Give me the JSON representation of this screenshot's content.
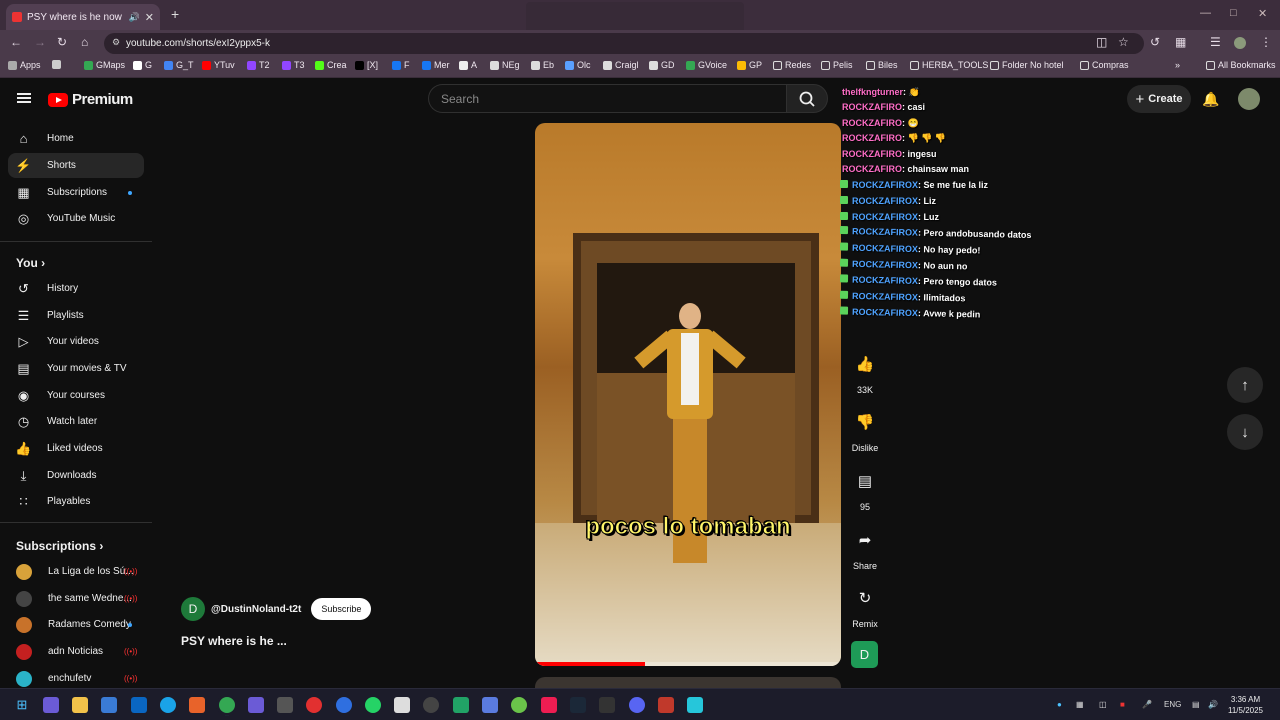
{
  "browser": {
    "tab_title": "PSY where is he now #fyp #",
    "url": "youtube.com/shorts/exI2yppx5-k",
    "bookmarks": [
      "Apps",
      "GMaps",
      "G",
      "G_T",
      "YTuv",
      "T2",
      "T3",
      "Crea",
      "[X]",
      "F",
      "Mer",
      "A",
      "NEg",
      "Eb",
      "Olc",
      "Craigl",
      "GD",
      "GVoice",
      "GP",
      "Redes",
      "Pelis",
      "Biles",
      "HERBA_TOOLS",
      "Folder No hotel",
      "Compras",
      "All Bookmarks"
    ]
  },
  "header": {
    "logo_text": "Premium",
    "search_placeholder": "Search",
    "create_label": "Create"
  },
  "sidebar": {
    "main": [
      "Home",
      "Shorts",
      "Subscriptions",
      "YouTube Music"
    ],
    "you_title": "You",
    "you_items": [
      "History",
      "Playlists",
      "Your videos",
      "Your movies & TV",
      "Your courses",
      "Watch later",
      "Liked videos",
      "Downloads",
      "Playables"
    ],
    "subs_title": "Subscriptions",
    "subs": [
      "La Liga de los Sú...",
      "the same Wedne...",
      "Radames Comedy",
      "adn Noticias",
      "enchufetv"
    ]
  },
  "short": {
    "caption": "pocos lo tomaban",
    "channel_initial": "D",
    "channel": "@DustinNoland-t2t",
    "subscribe": "Subscribe",
    "title": "PSY where is he ...",
    "progress": 0.36
  },
  "actions": {
    "likes": "33K",
    "dislike": "Dislike",
    "comments": "95",
    "share": "Share",
    "remix": "Remix",
    "remix_initial": "D"
  },
  "chat": [
    {
      "user": "thelfkngturner",
      "msg": ": 👏"
    },
    {
      "user": "ROCKZAFIRO",
      "msg": ": casi"
    },
    {
      "user": "ROCKZAFIRO",
      "msg": ": 😁"
    },
    {
      "user": "ROCKZAFIRO",
      "msg": ": 👎 👎 👎"
    },
    {
      "user": "ROCKZAFIRO",
      "msg": ": ingesu"
    },
    {
      "user": "ROCKZAFIRO",
      "msg": ": chainsaw man"
    },
    {
      "user": "ROCKZAFIROX",
      "msg": ": Se me fue la liz"
    },
    {
      "user": "ROCKZAFIROX",
      "msg": ": Liz"
    },
    {
      "user": "ROCKZAFIROX",
      "msg": ": Luz"
    },
    {
      "user": "ROCKZAFIROX",
      "msg": ": Pero andobusando datos"
    },
    {
      "user": "ROCKZAFIROX",
      "msg": ": No hay pedo!"
    },
    {
      "user": "ROCKZAFIROX",
      "msg": ": No aun no"
    },
    {
      "user": "ROCKZAFIROX",
      "msg": ": Pero tengo datos"
    },
    {
      "user": "ROCKZAFIROX",
      "msg": ": Ilimitados"
    },
    {
      "user": "ROCKZAFIROX",
      "msg": ": Avwe k pedin"
    }
  ],
  "taskbar": {
    "lang": "ENG",
    "time": "3:36 AM",
    "date": "11/5/2025"
  }
}
